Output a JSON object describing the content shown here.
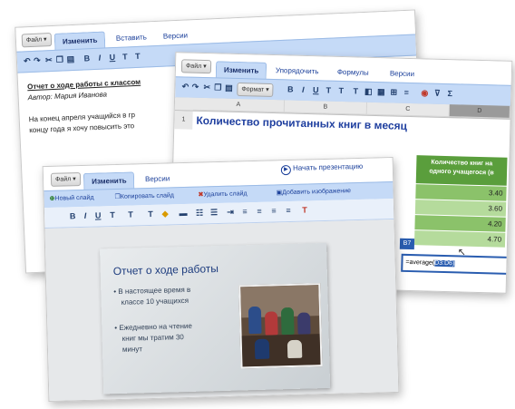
{
  "doc_window": {
    "file_btn": "Файл ▾",
    "tabs": [
      "Изменить",
      "Вставить",
      "Версии"
    ],
    "heading": "Отчет о ходе работы с классом",
    "author": "Автор: Мария Иванова",
    "body_line1": "На конец апреля учащийся в гр",
    "body_line2": "концу года я хочу повысить это"
  },
  "sheet_window": {
    "file_btn": "Файл ▾",
    "tabs": [
      "Изменить",
      "Упорядочить",
      "Формулы",
      "Версии"
    ],
    "format_btn": "Формат ▾",
    "col_headers": [
      "A",
      "B",
      "C",
      "D"
    ],
    "row_number": "1",
    "title": "Количество прочитанных книг в месяц",
    "col_d_header_line1": "Количество книг на",
    "col_d_header_line2": "одного учащегося (в",
    "values": [
      "3.40",
      "3.60",
      "4.20",
      "4.70"
    ],
    "active_cell_label": "B7",
    "formula_text": "=average(",
    "formula_highlight": "D3:D6)"
  },
  "slides_window": {
    "file_btn": "Файл ▾",
    "tabs": [
      "Изменить",
      "Версии"
    ],
    "start_presentation": "Начать презентацию",
    "actions": [
      "Новый слайд",
      "Копировать слайд",
      "Удалить слайд",
      "Добавить изображение"
    ],
    "slide_title": "Отчет о ходе работы",
    "bullet1": [
      "В настоящее время в",
      "классе 10 учащихся"
    ],
    "bullet2": [
      "Ежедневно на чтение",
      "книг мы тратим 30",
      "минут"
    ]
  },
  "colors": {
    "tab_blue": "#c5daf7",
    "title_blue": "#1f3f9f",
    "green_cells": "#6fae52",
    "slide_bg": "#d9dde0"
  }
}
